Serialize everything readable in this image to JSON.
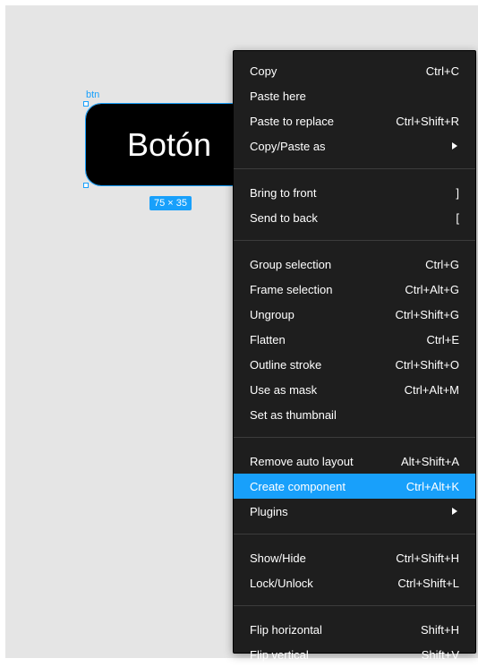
{
  "canvas": {
    "layer_name": "btn",
    "button_text": "Botón",
    "size_badge": "75 × 35"
  },
  "context_menu": {
    "groups": [
      [
        {
          "label": "Copy",
          "shortcut": "Ctrl+C"
        },
        {
          "label": "Paste here",
          "shortcut": ""
        },
        {
          "label": "Paste to replace",
          "shortcut": "Ctrl+Shift+R"
        },
        {
          "label": "Copy/Paste as",
          "shortcut": "",
          "submenu": true
        }
      ],
      [
        {
          "label": "Bring to front",
          "shortcut": "]"
        },
        {
          "label": "Send to back",
          "shortcut": "["
        }
      ],
      [
        {
          "label": "Group selection",
          "shortcut": "Ctrl+G"
        },
        {
          "label": "Frame selection",
          "shortcut": "Ctrl+Alt+G"
        },
        {
          "label": "Ungroup",
          "shortcut": "Ctrl+Shift+G"
        },
        {
          "label": "Flatten",
          "shortcut": "Ctrl+E"
        },
        {
          "label": "Outline stroke",
          "shortcut": "Ctrl+Shift+O"
        },
        {
          "label": "Use as mask",
          "shortcut": "Ctrl+Alt+M"
        },
        {
          "label": "Set as thumbnail",
          "shortcut": ""
        }
      ],
      [
        {
          "label": "Remove auto layout",
          "shortcut": "Alt+Shift+A"
        },
        {
          "label": "Create component",
          "shortcut": "Ctrl+Alt+K",
          "highlighted": true
        },
        {
          "label": "Plugins",
          "shortcut": "",
          "submenu": true
        }
      ],
      [
        {
          "label": "Show/Hide",
          "shortcut": "Ctrl+Shift+H"
        },
        {
          "label": "Lock/Unlock",
          "shortcut": "Ctrl+Shift+L"
        }
      ],
      [
        {
          "label": "Flip horizontal",
          "shortcut": "Shift+H"
        },
        {
          "label": "Flip vertical",
          "shortcut": "Shift+V"
        }
      ]
    ]
  },
  "colors": {
    "selection": "#18a0fb",
    "menu_bg": "#1e1e1e",
    "canvas_bg": "#e5e5e5"
  }
}
